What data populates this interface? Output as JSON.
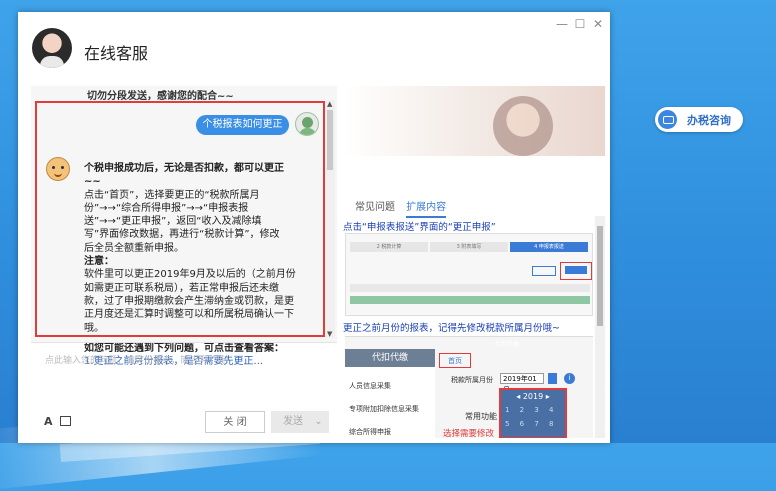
{
  "window": {
    "title": "在线客服",
    "controls": [
      "—",
      "☐",
      "✕"
    ]
  },
  "chat": {
    "banner": "切勿分段发送，感谢您的配合~~",
    "user_message": "个税报表如何更正",
    "answer_lines": [
      {
        "text": "个税申报成功后，无论是否扣款，都可以更正~~",
        "bold": true
      },
      {
        "text": "点击“首页”，选择要更正的“税款所属月",
        "bold": false
      },
      {
        "text": "份”→→“综合所得申报”→→“申报表报",
        "bold": false
      },
      {
        "text": "送”→→“更正申报”，返回“收入及减除填",
        "bold": false
      },
      {
        "text": "写”界面修改数据，再进行“税款计算”，修改",
        "bold": false
      },
      {
        "text": "后全员全额重新申报。",
        "bold": false
      },
      {
        "text": "注意：",
        "bold": true
      },
      {
        "text": "软件里可以更正2019年9月及以后的（之前月份",
        "bold": false
      },
      {
        "text": "如需更正可联系税局），若正常申报后还未缴",
        "bold": false
      },
      {
        "text": "款，过了申报期缴款会产生滞纳金或罚款，是更",
        "bold": false
      },
      {
        "text": "正月度还是汇算时调整可以和所属税局确认一下",
        "bold": false
      },
      {
        "text": "哦。",
        "bold": false
      }
    ],
    "question_header": "如您可能还遇到下列问题，可点击查看答案：",
    "cut_link": "1.更正之前月份报表，是否需要先更正..."
  },
  "input": {
    "placeholder": "点此输入您的问题，请突出重点，简洁明了哦！",
    "close_label": "关 闭",
    "send_label": "发送"
  },
  "right": {
    "tabs": [
      {
        "label": "常见问题",
        "active": false
      },
      {
        "label": "扩展内容",
        "active": true
      }
    ],
    "step1_text": "点击“申报表报送”界面的“更正申报”",
    "steps": [
      "2 税款计算",
      "3 附表填写",
      "4 申报表报送"
    ],
    "step2_text": "更正之前月份的报表，记得先修改税款所属月份哦~",
    "sidebar_header": "代扣代缴",
    "sidebar_items": [
      "人员信息采集",
      "专项附加扣除信息采集",
      "综合所得申报"
    ],
    "home_label": "首页",
    "period_label": "税款所属月份",
    "period_value": "2019年01月",
    "calendar_year": "2019",
    "calendar_row1": "1 2 3 4",
    "calendar_row2": "5 6 7 8",
    "common_func": "常用功能",
    "red_hint": "选择需要修改",
    "fade_text": "代扣代缴"
  },
  "chip": {
    "label": "办税咨询"
  }
}
